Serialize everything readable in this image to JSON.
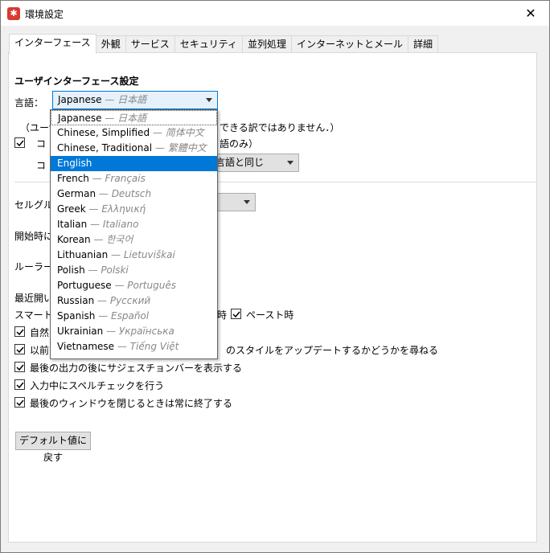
{
  "window": {
    "title": "環境設定",
    "close_glyph": "✕"
  },
  "tabs": [
    {
      "label": "インターフェース",
      "active": true
    },
    {
      "label": "外観"
    },
    {
      "label": "サービス"
    },
    {
      "label": "セキュリティ"
    },
    {
      "label": "並列処理"
    },
    {
      "label": "インターネットとメール"
    },
    {
      "label": "詳細"
    }
  ],
  "ui_section": {
    "heading": "ユーザインターフェース設定",
    "language_label": "言語：",
    "language_value": "Japanese",
    "language_native": " — 日本語",
    "note_prefix": "（ユーザ",
    "note_suffix": "できる訳ではありません．）",
    "checkbox_line_prefix": "コ",
    "checkbox_line_suffix": "語のみ）",
    "combo2_prefix": "コ",
    "combo2_value": "言語と同じ"
  },
  "lower": {
    "cell_group_prefix": "セルグル",
    "startup_prefix": "開始時に",
    "ruler_prefix": "ルーラーの",
    "recent_prefix": "最近開い",
    "smart_prefix": "スマートク",
    "smart_mid": "時",
    "paste_label": "ペースト時",
    "natural_prefix": "自然",
    "prev_prefix": "以前",
    "prev_suffix": "のスタイルをアップデートするかどうかを尋ねる",
    "suggestion_bar": "最後の出力の後にサジェスチョンバーを表示する",
    "spellcheck": "入力中にスペルチェックを行う",
    "quit_on_close": "最後のウィンドウを閉じるときは常に終了する",
    "reset_button": "デフォルト値に戻す"
  },
  "dropdown": {
    "items": [
      {
        "name": "Japanese",
        "native": " — 日本語"
      },
      {
        "name": "Chinese, Simplified",
        "native": " — 简体中文"
      },
      {
        "name": "Chinese, Traditional",
        "native": " — 繁體中文"
      },
      {
        "name": "English",
        "native": "",
        "selected": true
      },
      {
        "name": "French",
        "native": " — Français"
      },
      {
        "name": "German",
        "native": " — Deutsch"
      },
      {
        "name": "Greek",
        "native": " — Ελληνική"
      },
      {
        "name": "Italian",
        "native": " — Italiano"
      },
      {
        "name": "Korean",
        "native": " — 한국어"
      },
      {
        "name": "Lithuanian",
        "native": " — Lietuviškai"
      },
      {
        "name": "Polish",
        "native": " — Polski"
      },
      {
        "name": "Portuguese",
        "native": " — Português"
      },
      {
        "name": "Russian",
        "native": " — Русский"
      },
      {
        "name": "Spanish",
        "native": " — Español"
      },
      {
        "name": "Ukrainian",
        "native": " — Українська"
      },
      {
        "name": "Vietnamese",
        "native": " — Tiếng Việt"
      }
    ]
  },
  "colors": {
    "accent": "#0078d7",
    "app_icon": "#d63b2f"
  }
}
